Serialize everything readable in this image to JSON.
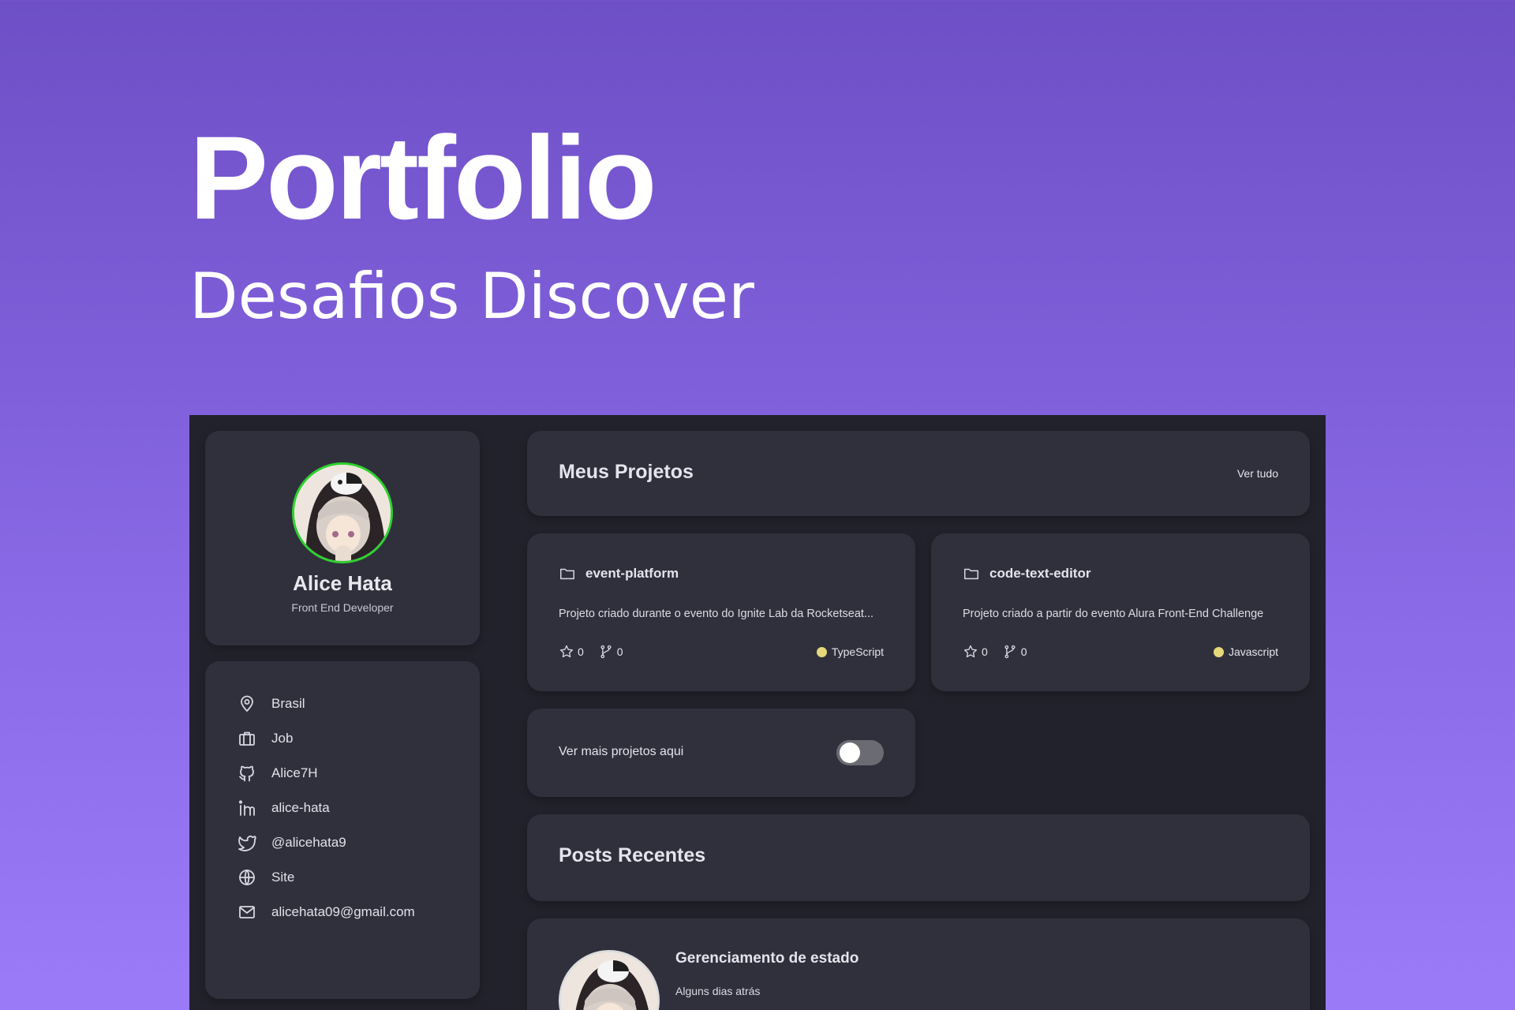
{
  "hero": {
    "title": "Portfolio",
    "subtitle": "Desafios Discover"
  },
  "profile": {
    "name": "Alice Hata",
    "role": "Front End Developer",
    "avatar_ring_color": "#2ed12e"
  },
  "info": {
    "items": [
      {
        "icon": "location-pin-icon",
        "label": "Brasil"
      },
      {
        "icon": "briefcase-icon",
        "label": "Job"
      },
      {
        "icon": "github-icon",
        "label": "Alice7H"
      },
      {
        "icon": "linkedin-icon",
        "label": "alice-hata"
      },
      {
        "icon": "twitter-icon",
        "label": "@alicehata9"
      },
      {
        "icon": "globe-icon",
        "label": "Site"
      },
      {
        "icon": "mail-icon",
        "label": "alicehata09@gmail.com"
      }
    ]
  },
  "projects": {
    "title": "Meus Projetos",
    "see_all": "Ver tudo",
    "repos": [
      {
        "name": "event-platform",
        "description": "Projeto criado durante o evento do Ignite Lab da Rocketseat...",
        "stars": "0",
        "forks": "0",
        "language": "TypeScript",
        "lang_color": "#e6d97a"
      },
      {
        "name": "code-text-editor",
        "description": "Projeto criado a partir do evento Alura Front-End Challenge",
        "stars": "0",
        "forks": "0",
        "language": "Javascript",
        "lang_color": "#e6d97a"
      }
    ],
    "more_label": "Ver mais projetos aqui",
    "more_toggle_on": false
  },
  "posts": {
    "title": "Posts Recentes",
    "items": [
      {
        "title": "Gerenciamento de estado",
        "date": "Alguns dias atrás"
      }
    ]
  },
  "colors": {
    "panel": "#30303d",
    "app_bg": "#22222c",
    "hero_gradient_top": "#6e4fc6",
    "hero_gradient_bottom": "#9b7bf7"
  }
}
